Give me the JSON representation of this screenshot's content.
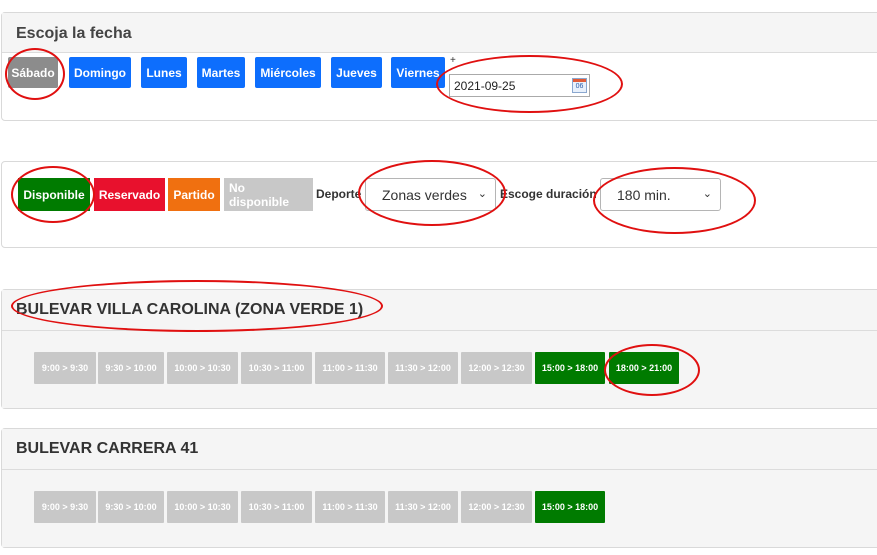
{
  "date_panel": {
    "title": "Escoja la fecha",
    "days": [
      "Sábado",
      "Domingo",
      "Lunes",
      "Martes",
      "Miércoles",
      "Jueves",
      "Viernes"
    ],
    "selected_day": "Sábado",
    "plus_label": "+",
    "date_value": "2021-09-25",
    "calendar_icon_text": "06"
  },
  "legend_panel": {
    "badges": [
      {
        "label": "Disponible",
        "color": "#007b00"
      },
      {
        "label": "Reservado",
        "color": "#e8112d"
      },
      {
        "label": "Partido",
        "color": "#f07010"
      },
      {
        "label": "No disponible",
        "color": "#c8c8c8"
      }
    ],
    "sport_label": "Deporte",
    "sport_value": "Zonas verdes",
    "duration_label": "Escoge duración",
    "duration_value": "180 min."
  },
  "venues": [
    {
      "name": "BULEVAR VILLA CAROLINA (ZONA VERDE 1)",
      "slots": [
        {
          "label": "9:00 > 9:30",
          "status": "No disponible"
        },
        {
          "label": "9:30 > 10:00",
          "status": "No disponible"
        },
        {
          "label": "10:00 > 10:30",
          "status": "No disponible"
        },
        {
          "label": "10:30 > 11:00",
          "status": "No disponible"
        },
        {
          "label": "11:00 > 11:30",
          "status": "No disponible"
        },
        {
          "label": "11:30 > 12:00",
          "status": "No disponible"
        },
        {
          "label": "12:00 > 12:30",
          "status": "No disponible"
        },
        {
          "label": "15:00 > 18:00",
          "status": "Disponible"
        },
        {
          "label": "18:00 > 21:00",
          "status": "Disponible"
        }
      ]
    },
    {
      "name": "BULEVAR CARRERA 41",
      "slots": [
        {
          "label": "9:00 > 9:30",
          "status": "No disponible"
        },
        {
          "label": "9:30 > 10:00",
          "status": "No disponible"
        },
        {
          "label": "10:00 > 10:30",
          "status": "No disponible"
        },
        {
          "label": "10:30 > 11:00",
          "status": "No disponible"
        },
        {
          "label": "11:00 > 11:30",
          "status": "No disponible"
        },
        {
          "label": "11:30 > 12:00",
          "status": "No disponible"
        },
        {
          "label": "12:00 > 12:30",
          "status": "No disponible"
        },
        {
          "label": "15:00 > 18:00",
          "status": "Disponible"
        }
      ]
    }
  ],
  "colors": {
    "accent": "#0d6efd",
    "selected": "#8c8c8c",
    "annotation": "#e01010"
  }
}
